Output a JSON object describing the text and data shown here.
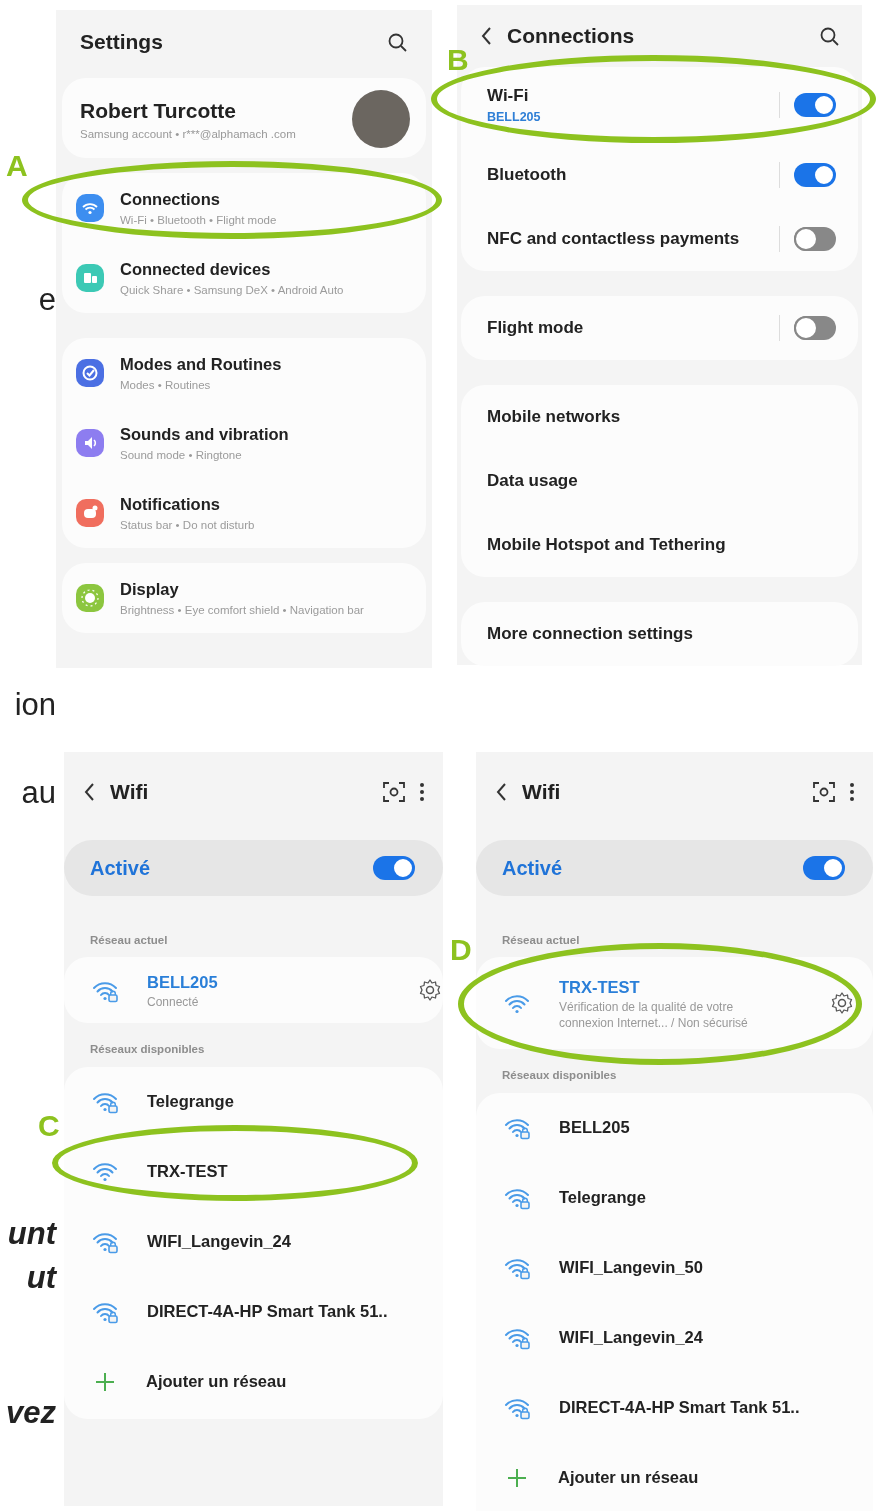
{
  "margin_text": [
    {
      "text": "e",
      "kind": "plain"
    },
    {
      "text": "ion",
      "kind": "plain"
    },
    {
      "text": "au",
      "kind": "plain"
    },
    {
      "text": "unt",
      "kind": "emphasis"
    },
    {
      "text": "ut",
      "kind": "emphasis"
    },
    {
      "text": "vez",
      "kind": "emphasis"
    }
  ],
  "settings_screen": {
    "callout": "A",
    "title": "Settings",
    "profile": {
      "name": "Robert Turcotte",
      "account": "Samsung account • r***@alphamach .com"
    },
    "groups": [
      [
        {
          "title": "Connections",
          "subtitle": "Wi-Fi • Bluetooth • Flight mode",
          "kind": "wifi",
          "color": "#3d8ef0",
          "highlighted": true
        },
        {
          "title": "Connected devices",
          "subtitle": "Quick Share • Samsung DeX • Android Auto",
          "kind": "devices",
          "color": "#3cc9b5",
          "highlighted": false
        }
      ],
      [
        {
          "title": "Modes and Routines",
          "subtitle": "Modes • Routines",
          "kind": "check",
          "color": "#4b6fe3",
          "highlighted": false
        },
        {
          "title": "Sounds and vibration",
          "subtitle": "Sound mode • Ringtone",
          "kind": "sound",
          "color": "#8d7df0",
          "highlighted": false
        },
        {
          "title": "Notifications",
          "subtitle": "Status bar • Do not disturb",
          "kind": "bell",
          "color": "#f06e5e",
          "highlighted": false
        }
      ],
      [
        {
          "title": "Display",
          "subtitle": "Brightness • Eye comfort shield • Navigation bar",
          "kind": "sun",
          "color": "#8cc63f",
          "highlighted": false
        }
      ]
    ]
  },
  "connections_screen": {
    "callout": "B",
    "title": "Connections",
    "groups": [
      [
        {
          "kind": "toggle",
          "title": "Wi-Fi",
          "subtitle": "BELL205",
          "on": true,
          "highlighted": true
        },
        {
          "kind": "toggle",
          "title": "Bluetooth",
          "on": true,
          "highlighted": false
        },
        {
          "kind": "toggle",
          "title": "NFC and contactless payments",
          "on": false,
          "highlighted": false
        }
      ],
      [
        {
          "kind": "toggle",
          "title": "Flight mode",
          "on": false,
          "highlighted": false
        }
      ],
      [
        {
          "kind": "link",
          "title": "Mobile networks",
          "highlighted": false
        },
        {
          "kind": "link",
          "title": "Data usage",
          "highlighted": false
        },
        {
          "kind": "link",
          "title": "Mobile Hotspot and Tethering",
          "highlighted": false
        }
      ],
      [
        {
          "kind": "link",
          "title": "More connection settings",
          "highlighted": false
        }
      ]
    ]
  },
  "wifi_screens": [
    {
      "callout": "C",
      "title": "Wifi",
      "master": {
        "label": "Activé",
        "on": true
      },
      "current_heading": "Réseau actuel",
      "current": {
        "name": "BELL205",
        "status": "Connecté",
        "secured": true,
        "highlighted": false
      },
      "available_heading": "Réseaux disponibles",
      "networks": [
        {
          "name": "Telegrange",
          "secured": true,
          "highlighted": false
        },
        {
          "name": "TRX-TEST",
          "secured": false,
          "highlighted": true
        },
        {
          "name": "WIFI_Langevin_24",
          "secured": true,
          "highlighted": false
        },
        {
          "name": "DIRECT-4A-HP Smart Tank 51..",
          "secured": true,
          "highlighted": false
        }
      ],
      "add_label": "Ajouter un réseau"
    },
    {
      "callout": "D",
      "title": "Wifi",
      "master": {
        "label": "Activé",
        "on": true
      },
      "current_heading": "Réseau actuel",
      "current": {
        "name": "TRX-TEST",
        "status": "Vérification de la qualité de votre connexion Internet... / Non sécurisé",
        "secured": false,
        "highlighted": true
      },
      "available_heading": "Réseaux disponibles",
      "networks": [
        {
          "name": "BELL205",
          "secured": true,
          "highlighted": false
        },
        {
          "name": "Telegrange",
          "secured": true,
          "highlighted": false
        },
        {
          "name": "WIFI_Langevin_50",
          "secured": true,
          "highlighted": false
        },
        {
          "name": "WIFI_Langevin_24",
          "secured": true,
          "highlighted": false
        },
        {
          "name": "DIRECT-4A-HP Smart Tank 51..",
          "secured": true,
          "highlighted": false
        }
      ],
      "add_label": "Ajouter un réseau"
    }
  ]
}
